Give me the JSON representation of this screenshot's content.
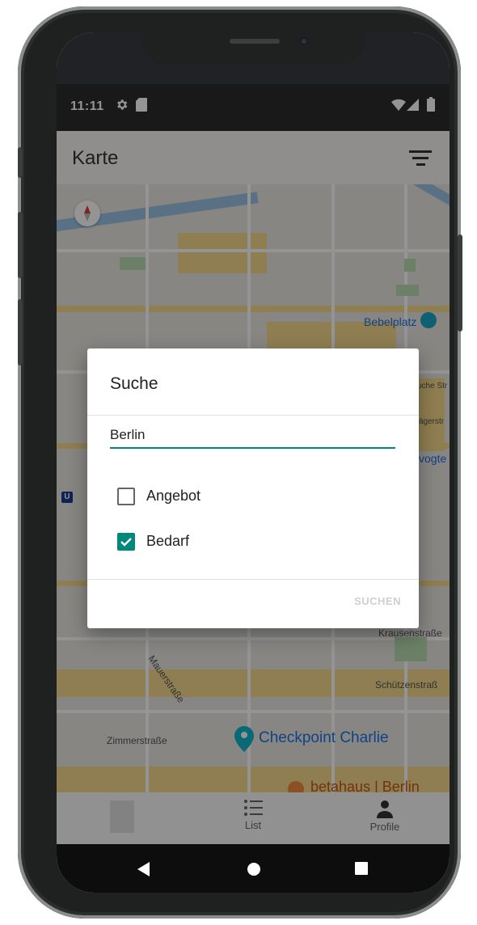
{
  "status_bar": {
    "time": "11:11",
    "icons": [
      "gear-icon",
      "sd-card-icon",
      "wifi-icon",
      "signal-icon",
      "battery-icon"
    ]
  },
  "app_bar": {
    "title": "Karte",
    "filter_icon": "filter-icon"
  },
  "map": {
    "labels": {
      "bebelplatz": "Bebelplatz",
      "krausenstrasse": "Krausenstraße",
      "schuetzenstrasse": "Schützenstraß",
      "zimmerstrasse": "Zimmerstraße",
      "checkpoint": "Checkpoint Charlie",
      "betahaus": "betahaus | Berlin",
      "mauerstrasse": "Mauerstraße",
      "vogte": "vogte",
      "ucheStr": "uche Str",
      "jagerstr": "ägerstr",
      "ubahn": "U"
    },
    "colors": {
      "water": "#9bc3e6",
      "road_major": "#f6d98c",
      "park": "#b8dcb0"
    }
  },
  "dialog": {
    "title": "Suche",
    "search_value": "Berlin",
    "options": [
      {
        "label": "Angebot",
        "checked": false
      },
      {
        "label": "Bedarf",
        "checked": true
      }
    ],
    "action_label": "SUCHEN"
  },
  "bottom_nav": {
    "items": [
      {
        "label": "",
        "icon": "map-icon"
      },
      {
        "label": "List",
        "icon": "list-icon"
      },
      {
        "label": "Profile",
        "icon": "person-icon"
      }
    ]
  },
  "system_nav": {
    "icons": [
      "back-icon",
      "home-icon",
      "recents-icon"
    ]
  },
  "accent_color": "#00897b"
}
